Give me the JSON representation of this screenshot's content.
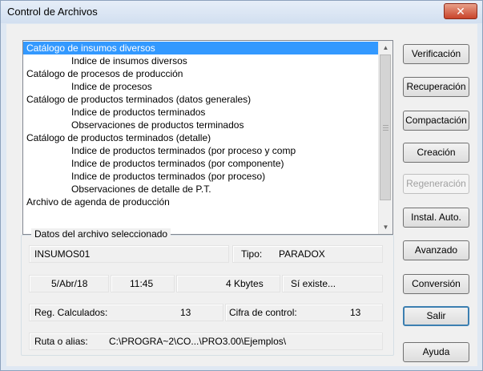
{
  "window": {
    "title": "Control de Archivos",
    "close_glyph": "✕"
  },
  "file_list": {
    "items": [
      {
        "label": "Catálogo de insumos diversos",
        "indent": false,
        "selected": true
      },
      {
        "label": "Indice de insumos diversos",
        "indent": true,
        "selected": false
      },
      {
        "label": "Catálogo de procesos de producción",
        "indent": false,
        "selected": false
      },
      {
        "label": "Indice de procesos",
        "indent": true,
        "selected": false
      },
      {
        "label": "Catálogo de productos terminados (datos generales)",
        "indent": false,
        "selected": false
      },
      {
        "label": "Indice de productos terminados",
        "indent": true,
        "selected": false
      },
      {
        "label": "Observaciones de productos terminados",
        "indent": true,
        "selected": false
      },
      {
        "label": "Catálogo de productos terminados (detalle)",
        "indent": false,
        "selected": false
      },
      {
        "label": "Indice de productos terminados (por proceso y comp",
        "indent": true,
        "selected": false
      },
      {
        "label": "Indice de productos terminados (por componente)",
        "indent": true,
        "selected": false
      },
      {
        "label": "Indice de productos terminados (por proceso)",
        "indent": true,
        "selected": false
      },
      {
        "label": "Observaciones de detalle de P.T.",
        "indent": true,
        "selected": false
      },
      {
        "label": "Archivo de agenda de producción",
        "indent": false,
        "selected": false
      }
    ]
  },
  "buttons": {
    "verificacion": "Verificación",
    "recuperacion": "Recuperación",
    "compactacion": "Compactación",
    "creacion": "Creación",
    "regeneracion": "Regeneración",
    "instal_auto": "Instal. Auto.",
    "avanzado": "Avanzado",
    "conversion": "Conversión",
    "salir": "Salir",
    "ayuda": "Ayuda"
  },
  "details": {
    "group_title": "Datos del archivo seleccionado",
    "name": "INSUMOS01",
    "type_label": "Tipo:",
    "type_value": "PARADOX",
    "date": "5/Abr/18",
    "time": "11:45",
    "size": "4 Kbytes",
    "exists": "Sí existe...",
    "reg_label": "Reg. Calculados:",
    "reg_value": "13",
    "checksum_label": "Cifra de control:",
    "checksum_value": "13",
    "path_label": "Ruta o alias:",
    "path_value": "C:\\PROGRA~2\\CO...\\PRO3.00\\Ejemplos\\"
  }
}
